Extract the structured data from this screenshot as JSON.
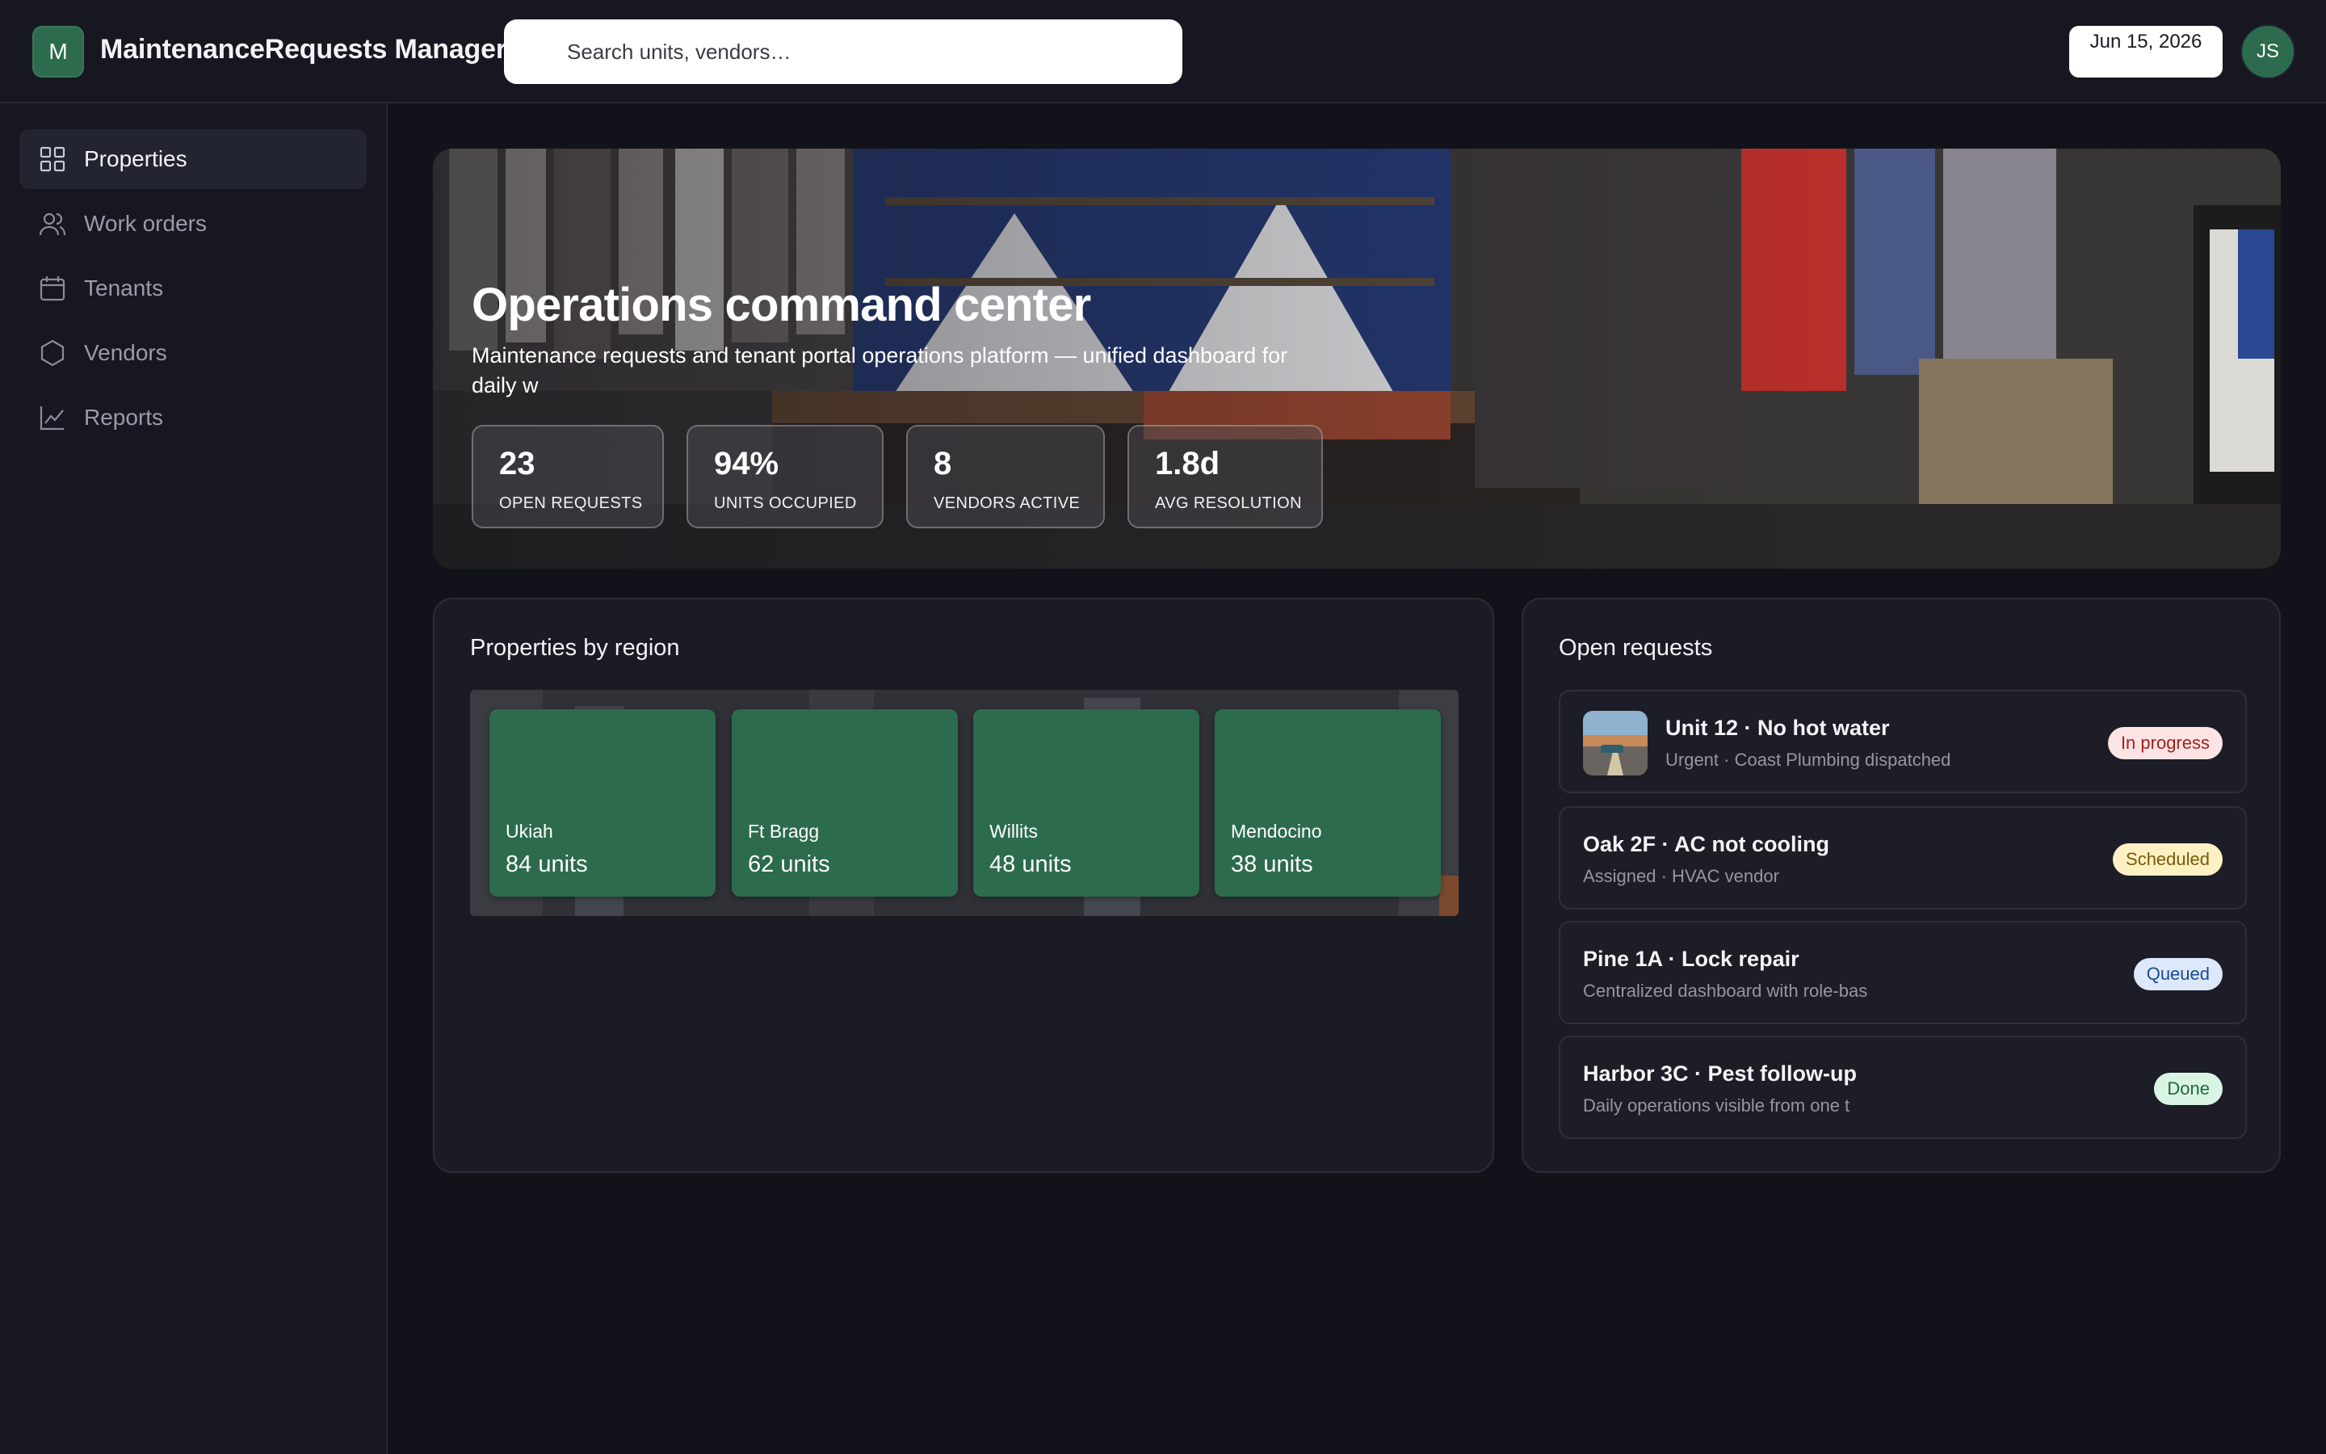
{
  "header": {
    "logo_letter": "M",
    "app_title": "MaintenanceRequests Manager",
    "search_placeholder": "Search units, vendors…",
    "date": "Jun 15, 2026",
    "avatar_initials": "JS"
  },
  "sidebar": {
    "items": [
      {
        "label": "Properties",
        "icon": "grid-icon",
        "active": true
      },
      {
        "label": "Work orders",
        "icon": "users-icon",
        "active": false
      },
      {
        "label": "Tenants",
        "icon": "calendar-icon",
        "active": false
      },
      {
        "label": "Vendors",
        "icon": "hexagon-icon",
        "active": false
      },
      {
        "label": "Reports",
        "icon": "line-chart-icon",
        "active": false
      }
    ]
  },
  "hero": {
    "title": "Operations command center",
    "subtitle": "Maintenance requests and tenant portal operations platform — unified dashboard for daily w",
    "stats": [
      {
        "value": "23",
        "label": "OPEN REQUESTS"
      },
      {
        "value": "94%",
        "label": "UNITS OCCUPIED"
      },
      {
        "value": "8",
        "label": "VENDORS ACTIVE"
      },
      {
        "value": "1.8d",
        "label": "AVG RESOLUTION"
      }
    ]
  },
  "regions": {
    "title": "Properties by region",
    "items": [
      {
        "name": "Ukiah",
        "units": "84 units"
      },
      {
        "name": "Ft Bragg",
        "units": "62 units"
      },
      {
        "name": "Willits",
        "units": "48 units"
      },
      {
        "name": "Mendocino",
        "units": "38 units"
      }
    ]
  },
  "requests": {
    "title": "Open requests",
    "items": [
      {
        "title": "Unit 12 · No hot water",
        "subtitle": "Urgent · Coast Plumbing dispatched",
        "status": "In progress",
        "has_thumb": true
      },
      {
        "title": "Oak 2F · AC not cooling",
        "subtitle": "Assigned · HVAC vendor",
        "status": "Scheduled"
      },
      {
        "title": "Pine 1A · Lock repair",
        "subtitle": "Centralized dashboard with role-bas",
        "status": "Queued"
      },
      {
        "title": "Harbor 3C · Pest follow-up",
        "subtitle": "Daily operations visible from one t",
        "status": "Done"
      }
    ]
  },
  "colors": {
    "accent": "#2c6b4e",
    "background": "#12131a",
    "surface": "#1a1b24"
  }
}
